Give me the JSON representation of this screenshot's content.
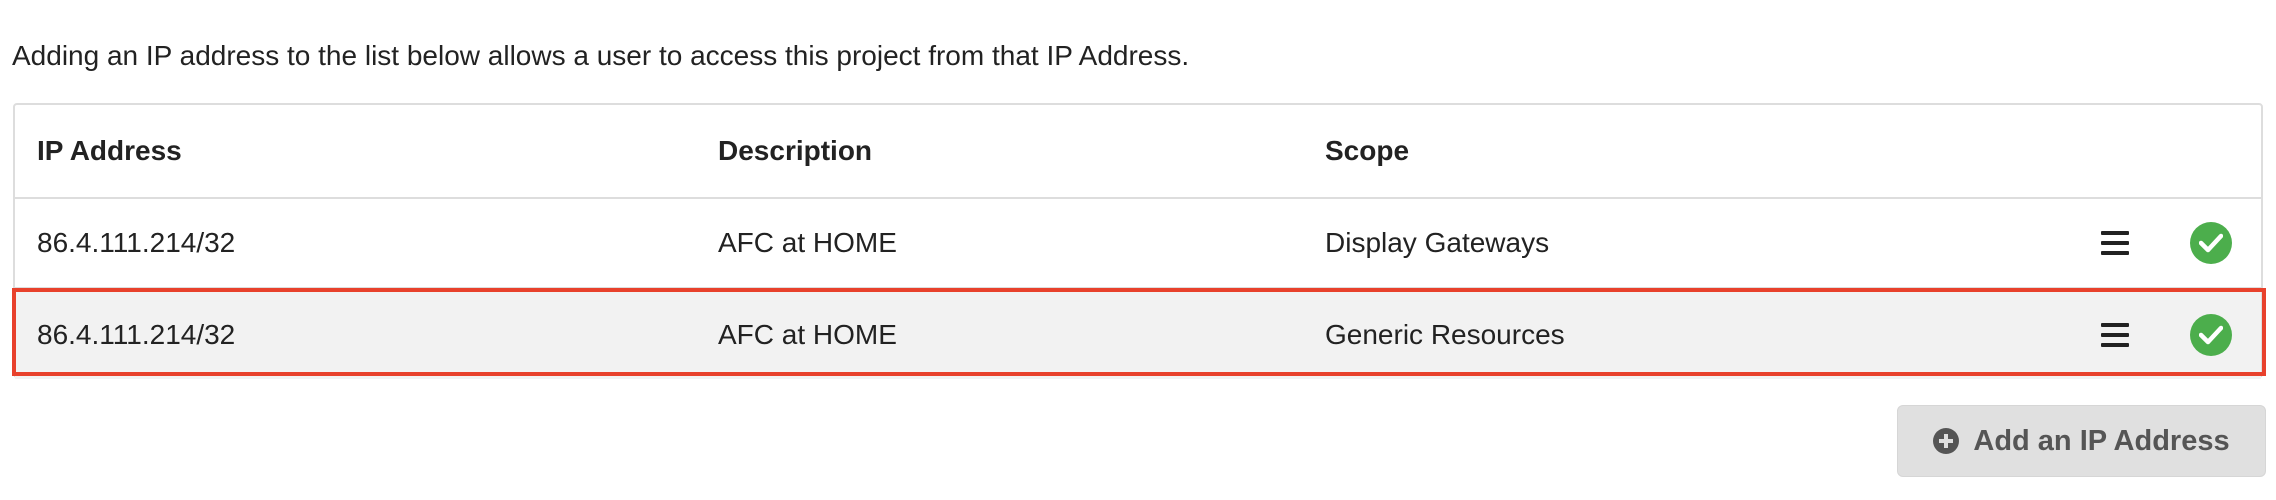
{
  "intro_text": "Adding an IP address to the list below allows a user to access this project from that IP Address.",
  "table": {
    "headers": {
      "ip": "IP Address",
      "description": "Description",
      "scope": "Scope"
    },
    "rows": [
      {
        "ip": "86.4.111.214/32",
        "description": "AFC at HOME",
        "scope": "Display Gateways",
        "menu_icon": "hamburger-menu-icon",
        "status_icon": "check-circle-icon",
        "highlighted": false
      },
      {
        "ip": "86.4.111.214/32",
        "description": "AFC at HOME",
        "scope": "Generic Resources",
        "menu_icon": "hamburger-menu-icon",
        "status_icon": "check-circle-icon",
        "highlighted": true
      }
    ]
  },
  "add_button": {
    "label": "Add an IP Address",
    "icon": "plus-circle-icon"
  },
  "colors": {
    "highlight_border": "#e8412c",
    "status_ok": "#4cae4c",
    "button_bg": "#e0e0e0",
    "button_text": "#555555"
  }
}
